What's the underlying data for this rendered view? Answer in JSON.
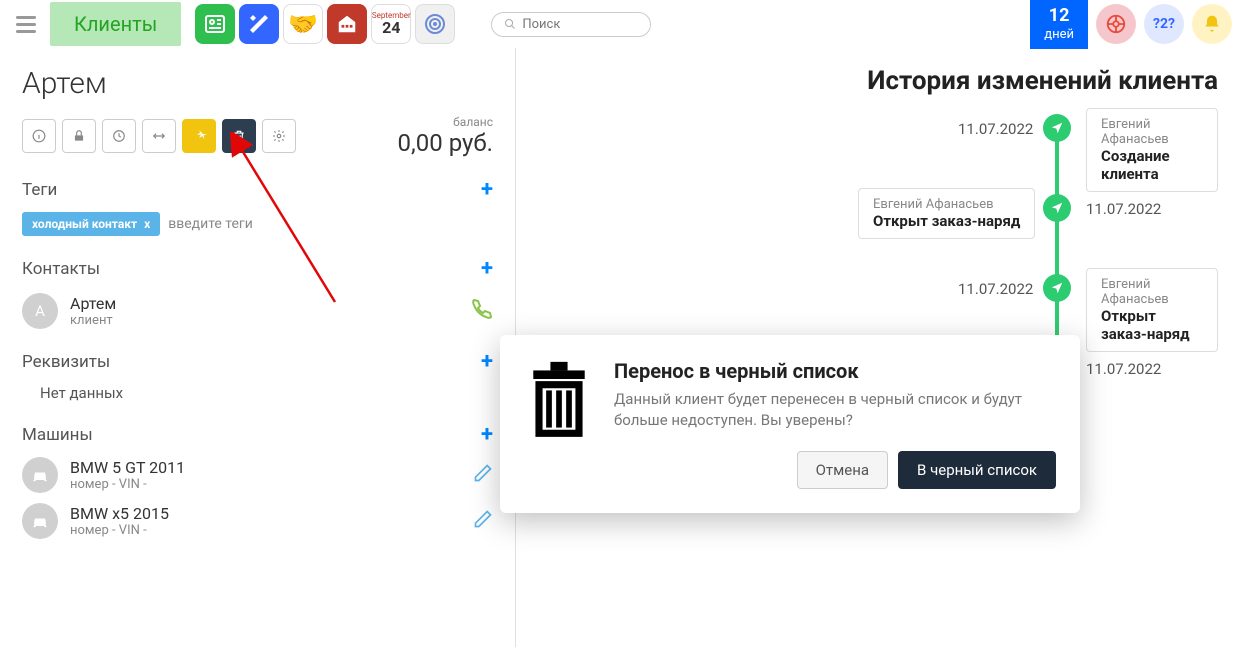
{
  "topbar": {
    "nav_tab": "Клиенты",
    "calendar_month": "September",
    "calendar_day": "24",
    "search_placeholder": "Поиск",
    "days_badge_num": "12",
    "days_badge_label": "дней",
    "help_label": "?2?"
  },
  "client": {
    "name": "Артем",
    "balance_label": "баланс",
    "balance_value": "0,00 руб."
  },
  "sections": {
    "tags": "Теги",
    "contacts": "Контакты",
    "requisites": "Реквизиты",
    "cars": "Машины"
  },
  "tags": {
    "chip": "холодный контакт",
    "chip_close": "x",
    "input_hint": "введите теги"
  },
  "contacts": [
    {
      "initial": "А",
      "name": "Артем",
      "role": "клиент"
    }
  ],
  "requisites_nodata": "Нет данных",
  "cars": [
    {
      "name": "BMW 5 GT 2011",
      "meta": "номер - VIN -"
    },
    {
      "name": "BMW x5 2015",
      "meta": "номер - VIN -"
    }
  ],
  "history": {
    "title": "История изменений клиента",
    "items": [
      {
        "date": "11.07.2022",
        "author": "Евгений Афанасьев",
        "action": "Создание клиента",
        "card_side": "right",
        "date_side": "left"
      },
      {
        "date": "11.07.2022",
        "author": "Евгений Афанасьев",
        "action": "Открыт заказ-наряд",
        "card_side": "left",
        "date_side": "right"
      },
      {
        "date": "11.07.2022",
        "author": "Евгений Афанасьев",
        "action": "Открыт заказ-наряд",
        "card_side": "right",
        "date_side": "left"
      },
      {
        "date": "11.07.2022",
        "author": "",
        "action": "",
        "card_side": "",
        "date_side": "right"
      }
    ]
  },
  "modal": {
    "title": "Перенос в черный список",
    "text": "Данный клиент будет перенесен в черный список и будут больше недоступен. Вы уверены?",
    "cancel": "Отмена",
    "confirm": "В черный список"
  }
}
